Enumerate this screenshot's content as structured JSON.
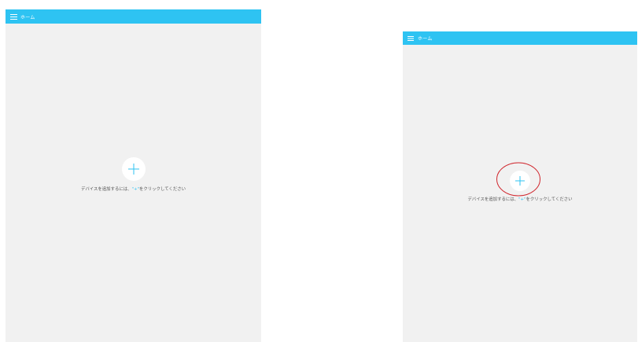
{
  "screens": [
    {
      "header_title": "ホーム",
      "hint_before": "デバイスを追加するには、",
      "hint_plus": "\"+\"",
      "hint_after": "をクリックしてください"
    },
    {
      "header_title": "ホーム",
      "hint_before": "デバイスを追加するには、",
      "hint_plus": "\"+\"",
      "hint_after": "をクリックしてください"
    }
  ],
  "colors": {
    "appbar": "#2ec3f2",
    "background": "#f1f1f1",
    "plus": "#2ec3f2",
    "highlight": "#d0262d"
  },
  "icons": {
    "menu": "hamburger-icon",
    "add": "plus-icon"
  }
}
